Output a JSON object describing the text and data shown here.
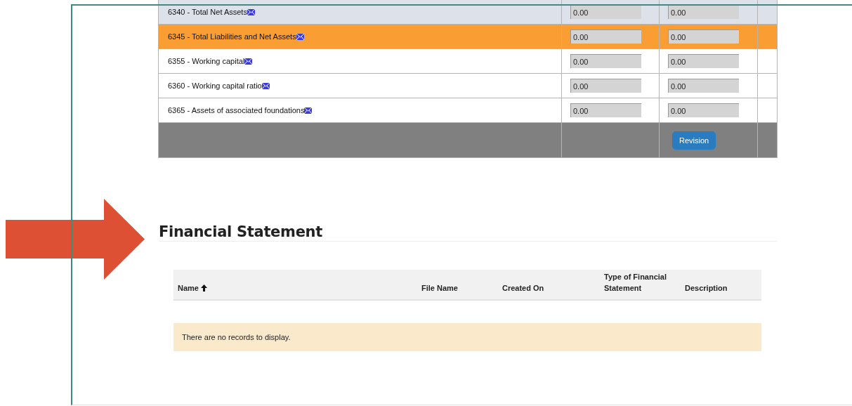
{
  "account_table": {
    "rows": [
      {
        "label": "6340 - Total Net Assets",
        "color": "#dde1e9",
        "value_1": "0.00",
        "value_2": "0.00"
      },
      {
        "label": "6345 - Total Liabilities and Net Assets",
        "color": "#fa9d33",
        "value_1": "0.00",
        "value_2": "0.00"
      },
      {
        "label": "6355 - Working capital",
        "color": "#ffffff",
        "value_1": "0.00",
        "value_2": "0.00"
      },
      {
        "label": "6360 - Working capital ratio",
        "color": "#ffffff",
        "value_1": "0.00",
        "value_2": "0.00"
      },
      {
        "label": "6365 - Assets of associated foundations",
        "color": "#ffffff",
        "value_1": "0.00",
        "value_2": "0.00"
      }
    ],
    "footer_button": "Revision"
  },
  "financial_statement": {
    "title": "Financial Statement",
    "columns": [
      {
        "label": "Name",
        "sorted": true
      },
      {
        "label": "File Name",
        "sorted": false
      },
      {
        "label": "Created On",
        "sorted": false
      },
      {
        "label": "Type of Financial Statement",
        "sorted": false
      },
      {
        "label": "Description",
        "sorted": false
      }
    ],
    "empty_message": "There are no records to display."
  }
}
